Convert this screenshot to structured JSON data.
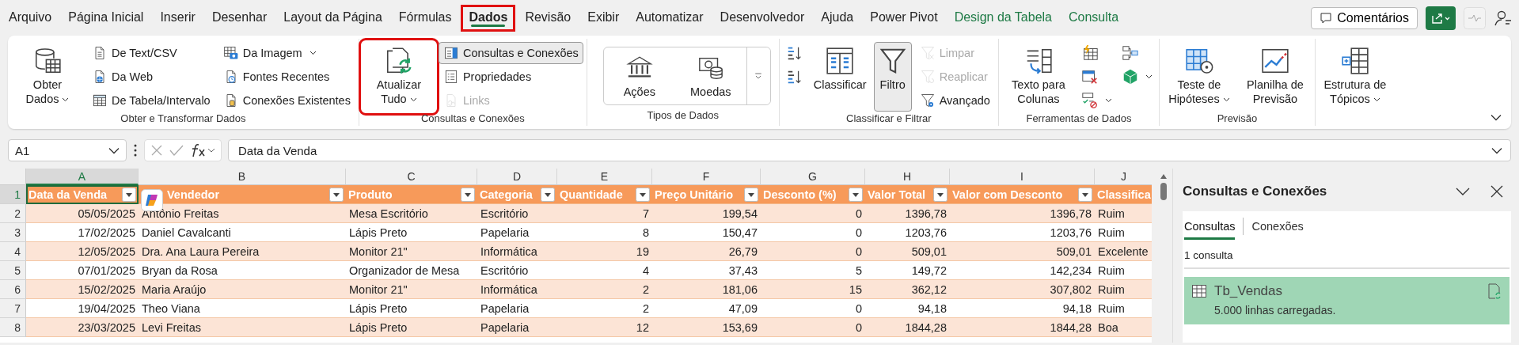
{
  "menu": {
    "tabs": [
      {
        "label": "Arquivo",
        "selected": false,
        "highlighted": false,
        "kind": "standard"
      },
      {
        "label": "Página Inicial",
        "selected": false,
        "highlighted": false,
        "kind": "standard"
      },
      {
        "label": "Inserir",
        "selected": false,
        "highlighted": false,
        "kind": "standard"
      },
      {
        "label": "Desenhar",
        "selected": false,
        "highlighted": false,
        "kind": "standard"
      },
      {
        "label": "Layout da Página",
        "selected": false,
        "highlighted": false,
        "kind": "standard"
      },
      {
        "label": "Fórmulas",
        "selected": false,
        "highlighted": false,
        "kind": "standard"
      },
      {
        "label": "Dados",
        "selected": true,
        "highlighted": true,
        "kind": "standard"
      },
      {
        "label": "Revisão",
        "selected": false,
        "highlighted": false,
        "kind": "standard"
      },
      {
        "label": "Exibir",
        "selected": false,
        "highlighted": false,
        "kind": "standard"
      },
      {
        "label": "Automatizar",
        "selected": false,
        "highlighted": false,
        "kind": "standard"
      },
      {
        "label": "Desenvolvedor",
        "selected": false,
        "highlighted": false,
        "kind": "standard"
      },
      {
        "label": "Ajuda",
        "selected": false,
        "highlighted": false,
        "kind": "standard"
      },
      {
        "label": "Power Pivot",
        "selected": false,
        "highlighted": false,
        "kind": "standard"
      },
      {
        "label": "Design da Tabela",
        "selected": false,
        "highlighted": false,
        "kind": "contextual"
      },
      {
        "label": "Consulta",
        "selected": false,
        "highlighted": false,
        "kind": "contextual"
      }
    ],
    "comments_button": "Comentários"
  },
  "ribbon": {
    "groups": [
      {
        "label": "Obter e Transformar Dados",
        "columns": [
          {
            "kind": "stack",
            "items": [
              {
                "label": "Obter Dados",
                "kind": "large",
                "dropdown": true,
                "disabled": false,
                "pressed": false,
                "highlighted": false
              }
            ]
          },
          {
            "kind": "stack",
            "items": [
              {
                "label": "De Text/CSV",
                "kind": "small",
                "dropdown": false,
                "disabled": false,
                "pressed": false,
                "highlighted": false
              },
              {
                "label": "Da Web",
                "kind": "small",
                "dropdown": false,
                "disabled": false,
                "pressed": false,
                "highlighted": false
              },
              {
                "label": "De Tabela/Intervalo",
                "kind": "small",
                "dropdown": false,
                "disabled": false,
                "pressed": false,
                "highlighted": false
              }
            ]
          },
          {
            "kind": "stack",
            "items": [
              {
                "label": "Da Imagem",
                "kind": "small",
                "dropdown": true,
                "disabled": false,
                "pressed": false,
                "highlighted": false
              },
              {
                "label": "Fontes Recentes",
                "kind": "small",
                "dropdown": false,
                "disabled": false,
                "pressed": false,
                "highlighted": false
              },
              {
                "label": "Conexões Existentes",
                "kind": "small",
                "dropdown": false,
                "disabled": false,
                "pressed": false,
                "highlighted": false
              }
            ]
          }
        ]
      },
      {
        "label": "Consultas e Conexões",
        "columns": [
          {
            "kind": "stack",
            "items": [
              {
                "label": "Atualizar Tudo",
                "kind": "large",
                "dropdown": true,
                "disabled": false,
                "pressed": false,
                "highlighted": true
              }
            ]
          },
          {
            "kind": "stack",
            "items": [
              {
                "label": "Consultas e Conexões",
                "kind": "small",
                "dropdown": false,
                "disabled": false,
                "pressed": true,
                "highlighted": false
              },
              {
                "label": "Propriedades",
                "kind": "small",
                "dropdown": false,
                "disabled": false,
                "pressed": false,
                "highlighted": false
              },
              {
                "label": "Links",
                "kind": "small",
                "dropdown": false,
                "disabled": true,
                "pressed": false,
                "highlighted": false
              }
            ]
          }
        ]
      },
      {
        "label": "Tipos de Dados",
        "columns": [
          {
            "kind": "gallery",
            "items": [
              {
                "label": "Ações",
                "kind": "large",
                "disabled": false,
                "pressed": false,
                "highlighted": false
              },
              {
                "label": "Moedas",
                "kind": "large",
                "disabled": false,
                "pressed": false,
                "highlighted": false
              },
              {
                "kind": "more"
              }
            ]
          }
        ]
      },
      {
        "label": "Classificar e Filtrar",
        "columns": [
          {
            "kind": "stack",
            "items": [
              {
                "kind": "icon",
                "dropdown": false,
                "disabled": false,
                "pressed": false,
                "highlighted": false
              },
              {
                "kind": "icon",
                "dropdown": false,
                "disabled": false,
                "pressed": false,
                "highlighted": false
              }
            ]
          },
          {
            "kind": "stack",
            "items": [
              {
                "label": "Classificar",
                "kind": "large",
                "dropdown": false,
                "disabled": false,
                "pressed": false,
                "highlighted": false
              }
            ]
          },
          {
            "kind": "stack",
            "items": [
              {
                "label": "Filtro",
                "kind": "large",
                "dropdown": false,
                "disabled": false,
                "pressed": true,
                "highlighted": false
              }
            ]
          },
          {
            "kind": "stack",
            "items": [
              {
                "label": "Limpar",
                "kind": "small",
                "dropdown": false,
                "disabled": true,
                "pressed": false,
                "highlighted": false
              },
              {
                "label": "Reaplicar",
                "kind": "small",
                "dropdown": false,
                "disabled": true,
                "pressed": false,
                "highlighted": false
              },
              {
                "label": "Avançado",
                "kind": "small",
                "dropdown": false,
                "disabled": false,
                "pressed": false,
                "highlighted": false
              }
            ]
          }
        ]
      },
      {
        "label": "Ferramentas de Dados",
        "columns": [
          {
            "kind": "stack",
            "items": [
              {
                "label": "Texto para Colunas",
                "kind": "large",
                "dropdown": false,
                "disabled": false,
                "pressed": false,
                "highlighted": false
              }
            ]
          },
          {
            "kind": "stack",
            "items": [
              {
                "kind": "icon",
                "dropdown": false,
                "disabled": false,
                "pressed": false,
                "highlighted": false
              },
              {
                "kind": "icon",
                "dropdown": false,
                "disabled": false,
                "pressed": false,
                "highlighted": false
              },
              {
                "kind": "icon",
                "dropdown": true,
                "disabled": false,
                "pressed": false,
                "highlighted": false
              }
            ]
          },
          {
            "kind": "stack",
            "items": [
              {
                "kind": "icon",
                "dropdown": false,
                "disabled": false,
                "pressed": false,
                "highlighted": false
              },
              {
                "kind": "icon",
                "dropdown": true,
                "disabled": false,
                "pressed": false,
                "highlighted": false
              }
            ]
          }
        ]
      },
      {
        "label": "Previsão",
        "columns": [
          {
            "kind": "stack",
            "items": [
              {
                "label": "Teste de Hipóteses",
                "kind": "large",
                "dropdown": true,
                "disabled": false,
                "pressed": false,
                "highlighted": false
              }
            ]
          },
          {
            "kind": "stack",
            "items": [
              {
                "label": "Planilha de Previsão",
                "kind": "large",
                "dropdown": false,
                "disabled": false,
                "pressed": false,
                "highlighted": false
              }
            ]
          }
        ]
      },
      {
        "columns": [
          {
            "kind": "stack",
            "items": [
              {
                "label": "Estrutura de Tópicos",
                "kind": "large",
                "dropdown": true,
                "disabled": false,
                "pressed": false,
                "highlighted": false
              }
            ]
          }
        ]
      }
    ]
  },
  "formula_bar": {
    "name_box": "A1",
    "formula": "Data da Venda"
  },
  "sheet": {
    "header_row": {
      "number": "1",
      "selected": true
    },
    "columns": [
      {
        "letter": "A",
        "header": "Data da Venda",
        "kind": "date",
        "selected": true
      },
      {
        "letter": "B",
        "header": "Vendedor",
        "kind": "text",
        "selected": false
      },
      {
        "letter": "C",
        "header": "Produto",
        "kind": "text",
        "selected": false
      },
      {
        "letter": "D",
        "header": "Categoria",
        "kind": "text",
        "selected": false
      },
      {
        "letter": "E",
        "header": "Quantidade",
        "kind": "number",
        "selected": false
      },
      {
        "letter": "F",
        "header": "Preço Unitário",
        "kind": "number",
        "selected": false
      },
      {
        "letter": "G",
        "header": "Desconto (%)",
        "kind": "number",
        "selected": false
      },
      {
        "letter": "H",
        "header": "Valor Total",
        "kind": "number",
        "selected": false
      },
      {
        "letter": "I",
        "header": "Valor com Desconto",
        "kind": "number",
        "selected": false
      },
      {
        "letter": "J",
        "header": "Classifica",
        "kind": "text",
        "selected": false
      }
    ],
    "rows": [
      {
        "number": "2",
        "selected": false,
        "cells": [
          "05/05/2025",
          "Antônio Freitas",
          "Mesa Escritório",
          "Escritório",
          "7",
          "199,54",
          "0",
          "1396,78",
          "1396,78",
          "Ruim"
        ]
      },
      {
        "number": "3",
        "selected": false,
        "cells": [
          "17/02/2025",
          "Daniel Cavalcanti",
          "Lápis Preto",
          "Papelaria",
          "8",
          "150,47",
          "0",
          "1203,76",
          "1203,76",
          "Ruim"
        ]
      },
      {
        "number": "4",
        "selected": false,
        "cells": [
          "12/05/2025",
          "Dra. Ana Laura Pereira",
          "Monitor 21\"",
          "Informática",
          "19",
          "26,79",
          "0",
          "509,01",
          "509,01",
          "Excelente"
        ]
      },
      {
        "number": "5",
        "selected": false,
        "cells": [
          "07/01/2025",
          "Bryan da Rosa",
          "Organizador de Mesa",
          "Escritório",
          "4",
          "37,43",
          "5",
          "149,72",
          "142,234",
          "Ruim"
        ]
      },
      {
        "number": "6",
        "selected": false,
        "cells": [
          "15/02/2025",
          "Maria Araújo",
          "Monitor 21\"",
          "Informática",
          "2",
          "181,06",
          "15",
          "362,12",
          "307,802",
          "Ruim"
        ]
      },
      {
        "number": "7",
        "selected": false,
        "cells": [
          "19/04/2025",
          "Theo Viana",
          "Lápis Preto",
          "Papelaria",
          "2",
          "47,09",
          "0",
          "94,18",
          "94,18",
          "Ruim"
        ]
      },
      {
        "number": "8",
        "selected": false,
        "cells": [
          "23/03/2025",
          "Levi Freitas",
          "Lápis Preto",
          "Papelaria",
          "12",
          "153,69",
          "0",
          "1844,28",
          "1844,28",
          "Boa"
        ]
      }
    ]
  },
  "pane": {
    "title": "Consultas e Conexões",
    "tabs": [
      {
        "label": "Consultas",
        "selected": true
      },
      {
        "label": "Conexões",
        "selected": false
      }
    ],
    "count": "1 consulta",
    "queries": [
      {
        "name": "Tb_Vendas",
        "status": "5.000 linhas carregadas.",
        "selected": true
      }
    ]
  }
}
